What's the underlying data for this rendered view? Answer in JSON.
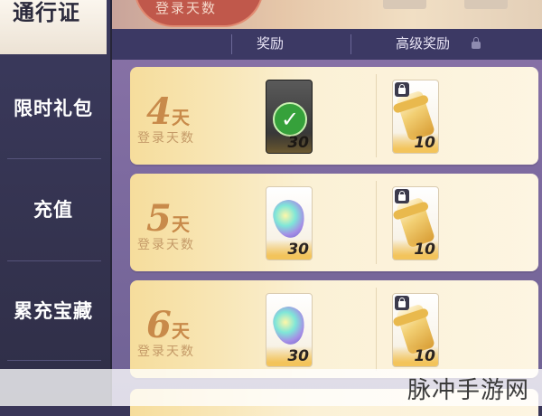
{
  "sidebar": {
    "items": [
      {
        "label": "通行证",
        "active": true
      },
      {
        "label": "限时礼包"
      },
      {
        "label": "充值"
      },
      {
        "label": "累充宝藏"
      }
    ]
  },
  "top": {
    "badge_label": "登录天数"
  },
  "header": {
    "reward_label": "奖励",
    "premium_label": "高级奖励"
  },
  "rows": [
    {
      "day_number": "4",
      "day_unit": "天",
      "day_label": "登录天数",
      "reward": {
        "qty": "30",
        "icon": "claimed-check-icon",
        "claimed": true
      },
      "premium": {
        "qty": "10",
        "icon": "scroll-icon",
        "locked": true
      }
    },
    {
      "day_number": "5",
      "day_unit": "天",
      "day_label": "登录天数",
      "reward": {
        "qty": "30",
        "icon": "crystal-icon",
        "claimed": false
      },
      "premium": {
        "qty": "10",
        "icon": "scroll-icon",
        "locked": true
      }
    },
    {
      "day_number": "6",
      "day_unit": "天",
      "day_label": "登录天数",
      "reward": {
        "qty": "30",
        "icon": "crystal-icon",
        "claimed": false
      },
      "premium": {
        "qty": "10",
        "icon": "scroll-icon",
        "locked": true
      }
    }
  ],
  "watermark": "脉冲手游网",
  "colors": {
    "sidebar_bg": "#3b3a5e",
    "row_gold": "#f6dd9c",
    "day_text": "#c88a4a",
    "header_bg": "#3c3964"
  }
}
